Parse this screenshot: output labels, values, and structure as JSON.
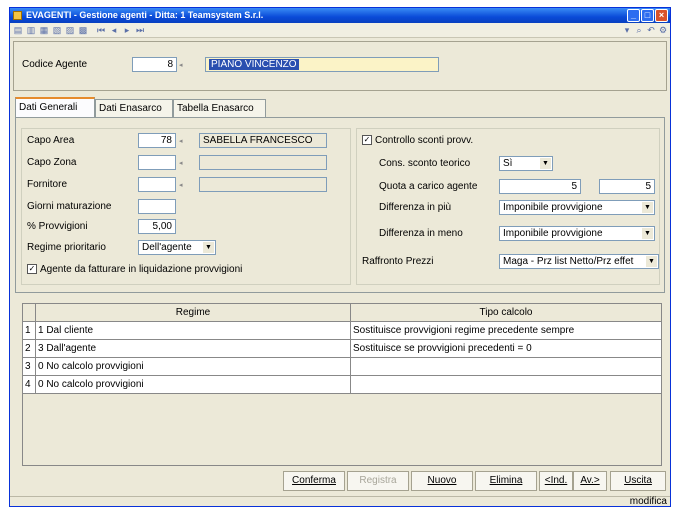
{
  "window": {
    "title": "EVAGENTI - Gestione agenti - Ditta:   1 Teamsystem S.r.l."
  },
  "header": {
    "codice_label": "Codice Agente",
    "codice_value": "8",
    "agent_name": "PIANO VINCENZO"
  },
  "tabs": [
    "Dati Generali",
    "Dati Enasarco",
    "Tabella Enasarco"
  ],
  "left": {
    "capo_area_label": "Capo Area",
    "capo_area_value": "78",
    "capo_area_name": "SABELLA FRANCESCO",
    "capo_zona_label": "Capo Zona",
    "capo_zona_value": "",
    "capo_zona_name": "",
    "fornitore_label": "Fornitore",
    "fornitore_value": "",
    "fornitore_name": "",
    "giorni_label": "Giorni maturazione",
    "giorni_value": "",
    "provvigioni_label": "% Provvigioni",
    "provvigioni_value": "5,00",
    "regime_label": "Regime prioritario",
    "regime_value": "Dell'agente",
    "fatturare_label": "Agente da fatturare in liquidazione provvigioni",
    "fatturare_checked": true
  },
  "right": {
    "controllo_label": "Controllo sconti provv.",
    "controllo_checked": true,
    "cons_label": "Cons. sconto teorico",
    "cons_value": "Sì",
    "quota_label": "Quota a carico agente",
    "quota_value1": "5",
    "quota_value2": "5",
    "diff_piu_label": "Differenza in più",
    "diff_piu_value": "Imponibile provvigione",
    "diff_meno_label": "Differenza in meno",
    "diff_meno_value": "Imponibile provvigione",
    "raffronto_label": "Raffronto Prezzi",
    "raffronto_value": "Maga - Prz list Netto/Prz effet"
  },
  "grid": {
    "headers": [
      "Regime",
      "Tipo calcolo"
    ],
    "rows": [
      {
        "n": "1",
        "regime": "1 Dal cliente",
        "tipo": "Sostituisce provvigioni regime precedente sempre"
      },
      {
        "n": "2",
        "regime": "3 Dall'agente",
        "tipo": "Sostituisce se provvigioni precedenti = 0"
      },
      {
        "n": "3",
        "regime": "0 No calcolo provvigioni",
        "tipo": ""
      },
      {
        "n": "4",
        "regime": "0 No calcolo provvigioni",
        "tipo": ""
      }
    ]
  },
  "buttons": {
    "conferma": "Conferma",
    "registra": "Registra",
    "nuovo": "Nuovo",
    "elimina": "Elimina",
    "ind": "<Ind.",
    "av": "Av.>",
    "uscita": "Uscita"
  },
  "status": {
    "mode": "modifica"
  }
}
